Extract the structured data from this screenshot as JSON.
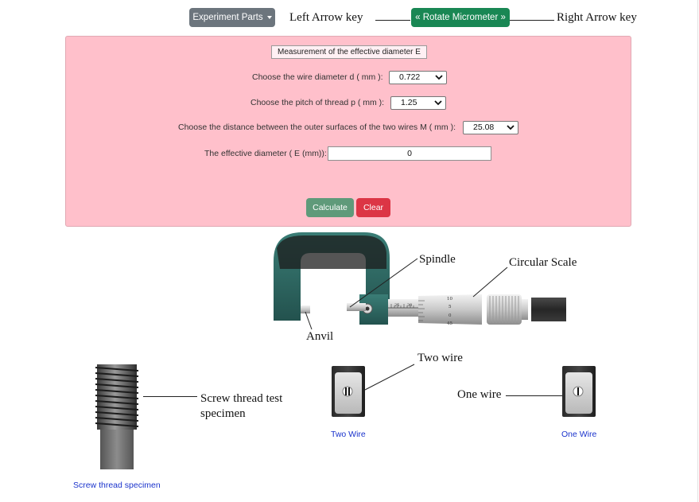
{
  "toolbar": {
    "experiment_parts_label": "Experiment Parts",
    "rotate_label": "« Rotate Micrometer »",
    "left_key_label": "Left Arrow key",
    "right_key_label": "Right Arrow key"
  },
  "form": {
    "title": "Measurement of the effective diameter E",
    "wire_diameter_label": "Choose the wire diameter d ( mm ):",
    "wire_diameter_value": "0.722",
    "pitch_label": "Choose the pitch of thread p ( mm ):",
    "pitch_value": "1.25",
    "distance_label": "Choose the distance between the outer surfaces of the two wires M ( mm ):",
    "distance_value": "25.08",
    "effective_label": "The effective diameter ( E (mm)):",
    "effective_value": "0",
    "calculate_label": "Calculate",
    "clear_label": "Clear"
  },
  "micrometer": {
    "spindle_label": "Spindle",
    "circular_scale_label": "Circular Scale",
    "anvil_label": "Anvil",
    "sleeve_numbers": [
      "25",
      "30"
    ],
    "thimble_numbers": [
      "10",
      "5",
      "0",
      "45"
    ]
  },
  "specimens": {
    "screw_label_line1": "Screw thread test",
    "screw_label_line2": "specimen",
    "screw_caption": "Screw thread specimen",
    "two_wire_label": "Two wire",
    "two_wire_caption": "Two Wire",
    "one_wire_label": "One wire",
    "one_wire_caption": "One Wire"
  },
  "colors": {
    "panel_pink": "#ffc0cb",
    "frame_teal": "#2f6f6a",
    "primary_green": "#198754",
    "danger_red": "#dc3545",
    "secondary_gray": "#6c757d",
    "link_blue": "#1a33cc"
  }
}
